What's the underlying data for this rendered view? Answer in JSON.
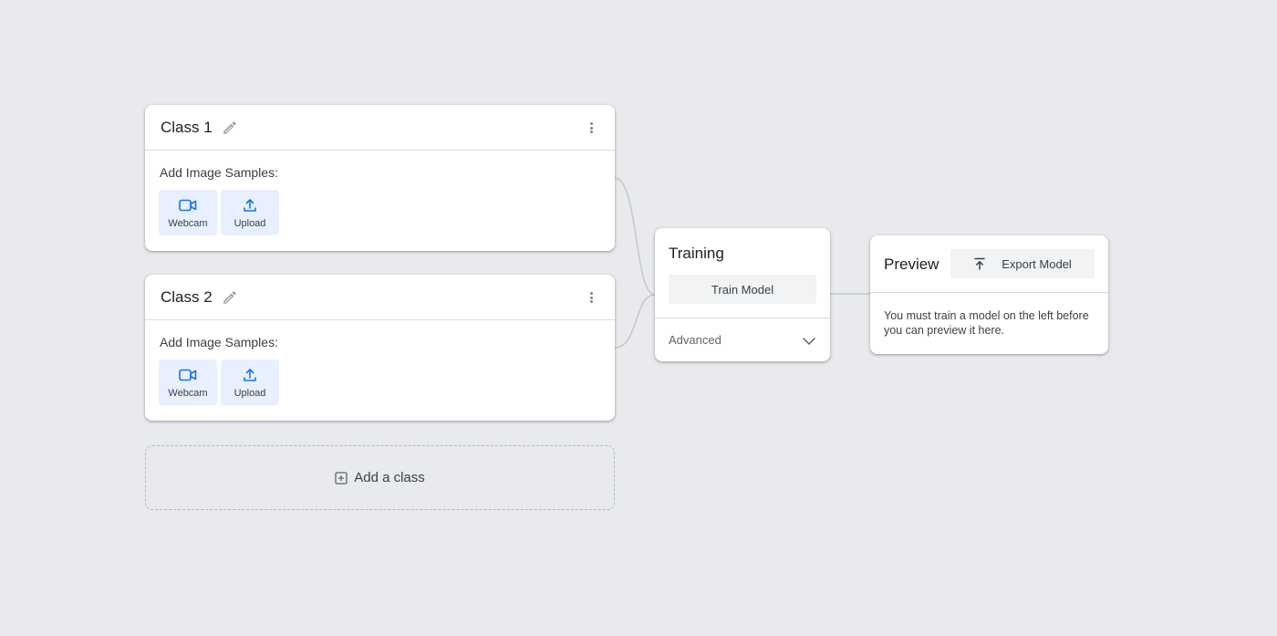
{
  "classes": [
    {
      "name": "Class 1",
      "samples_label": "Add Image Samples:",
      "webcam_label": "Webcam",
      "upload_label": "Upload"
    },
    {
      "name": "Class 2",
      "samples_label": "Add Image Samples:",
      "webcam_label": "Webcam",
      "upload_label": "Upload"
    }
  ],
  "add_class": {
    "label": "Add a class",
    "icon": "add-box-icon"
  },
  "training": {
    "title": "Training",
    "train_button": "Train Model",
    "advanced_label": "Advanced"
  },
  "preview": {
    "title": "Preview",
    "export_button": "Export Model",
    "message": "You must train a model on the left before you can preview it here."
  },
  "colors": {
    "background": "#e8eaed",
    "sample_button_bg": "#e8f0fe",
    "button_bg": "#f1f3f4",
    "connector": "#c4c7c5"
  },
  "icons": [
    "edit-pencil-icon",
    "more-vert-icon",
    "webcam-icon",
    "upload-icon",
    "add-box-icon",
    "chevron-down-icon",
    "export-icon"
  ]
}
